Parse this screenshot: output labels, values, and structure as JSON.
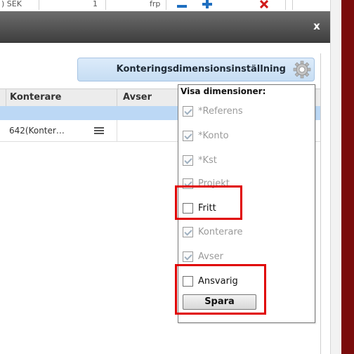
{
  "background_row": {
    "left_text": ") SEK",
    "qty": "1",
    "unit": "frp"
  },
  "dialog": {
    "close_label": "x",
    "settings_button_label": "Konteringsdimensionsinställning",
    "table": {
      "headers": [
        "Konterare",
        "Avser"
      ],
      "rows": [
        {
          "konterare": "642(Konter…",
          "avser": ""
        }
      ]
    },
    "dimensions_panel": {
      "title": "Visa dimensioner:",
      "options": [
        {
          "label": "*Referens",
          "checked": true,
          "enabled": false
        },
        {
          "label": "*Konto",
          "checked": true,
          "enabled": false
        },
        {
          "label": "*Kst",
          "checked": true,
          "enabled": false
        },
        {
          "label": "Projekt",
          "checked": true,
          "enabled": false
        },
        {
          "label": "Fritt",
          "checked": false,
          "enabled": true
        },
        {
          "label": "Konterare",
          "checked": true,
          "enabled": false
        },
        {
          "label": "Avser",
          "checked": true,
          "enabled": false
        },
        {
          "label": "Ansvarig",
          "checked": false,
          "enabled": true
        }
      ],
      "save_label": "Spara"
    }
  },
  "colors": {
    "titlebar": "#4a4a4a",
    "settings_button": "#cfe2f6",
    "row_highlight": "#bcd8f5",
    "annotation": "#e00000",
    "side_panel": "#7a0c0c"
  }
}
